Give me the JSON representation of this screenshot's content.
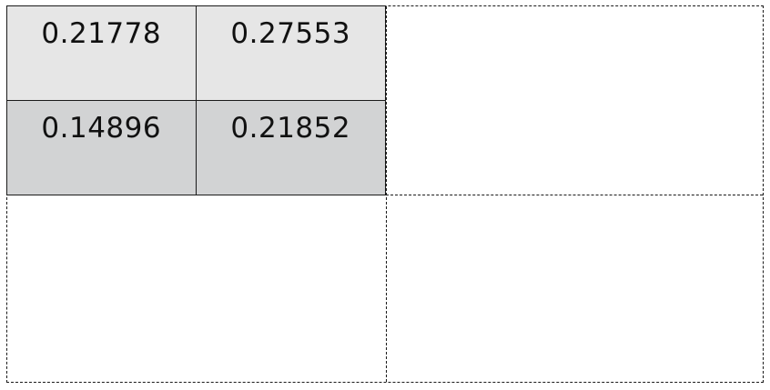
{
  "matrix": {
    "rows": [
      [
        "0.21778",
        "0.27553"
      ],
      [
        "0.14896",
        "0.21852"
      ]
    ],
    "colors": {
      "row_0_fill": "#e6e6e6",
      "row_1_fill": "#d2d3d4",
      "outline": "#1a1a1a"
    }
  }
}
